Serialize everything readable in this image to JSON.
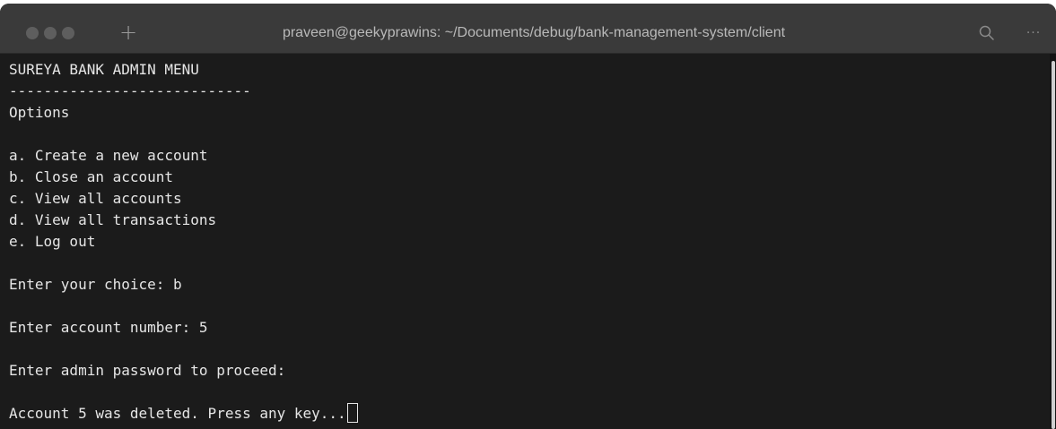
{
  "window": {
    "title": "praveen@geekyprawins: ~/Documents/debug/bank-management-system/client",
    "new_tab_label": "+",
    "more_label": "···",
    "icons": [
      "search-icon",
      "more-icon",
      "plus-icon"
    ]
  },
  "terminal": {
    "lines": [
      "SUREYA BANK ADMIN MENU",
      "----------------------------",
      "Options",
      "",
      "a. Create a new account",
      "b. Close an account",
      "c. View all accounts",
      "d. View all transactions",
      "e. Log out",
      "",
      "Enter your choice: b",
      "",
      "Enter account number: 5",
      "",
      "Enter admin password to proceed:",
      "",
      "Account 5 was deleted. Press any key..."
    ]
  },
  "colors": {
    "background": "#1b1b1b",
    "titlebar": "#3a3a3a",
    "text": "#e6e6e6",
    "title_text": "#b9b9b9"
  }
}
